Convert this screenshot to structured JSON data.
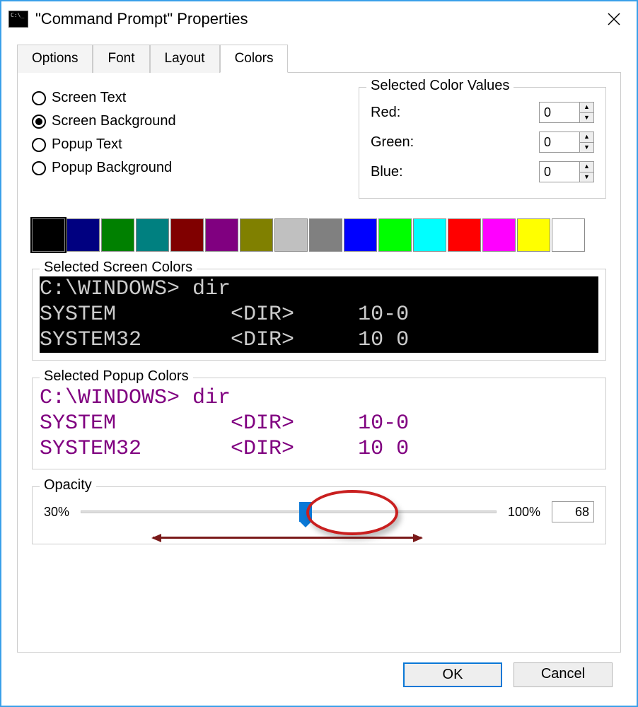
{
  "window": {
    "title": "\"Command Prompt\" Properties"
  },
  "tabs": {
    "items": [
      "Options",
      "Font",
      "Layout",
      "Colors"
    ],
    "active": 3
  },
  "radios": {
    "items": [
      {
        "label": "Screen Text",
        "selected": false
      },
      {
        "label": "Screen Background",
        "selected": true
      },
      {
        "label": "Popup Text",
        "selected": false
      },
      {
        "label": "Popup Background",
        "selected": false
      }
    ]
  },
  "color_values": {
    "legend": "Selected Color Values",
    "rows": [
      {
        "label": "Red:",
        "value": "0"
      },
      {
        "label": "Green:",
        "value": "0"
      },
      {
        "label": "Blue:",
        "value": "0"
      }
    ]
  },
  "palette": {
    "colors": [
      "#000000",
      "#000080",
      "#008000",
      "#008080",
      "#800000",
      "#800080",
      "#808000",
      "#c0c0c0",
      "#808080",
      "#0000ff",
      "#00ff00",
      "#00ffff",
      "#ff0000",
      "#ff00ff",
      "#ffff00",
      "#ffffff"
    ],
    "selected_index": 0
  },
  "preview_screen": {
    "legend": "Selected Screen Colors",
    "line1": "C:\\WINDOWS> dir",
    "line2": "SYSTEM         <DIR>     10-0",
    "line3": "SYSTEM32       <DIR>     10 0"
  },
  "preview_popup": {
    "legend": "Selected Popup Colors",
    "line1": "C:\\WINDOWS> dir",
    "line2": "SYSTEM         <DIR>     10-0",
    "line3": "SYSTEM32       <DIR>     10 0"
  },
  "opacity": {
    "legend": "Opacity",
    "min_label": "30%",
    "max_label": "100%",
    "value": "68",
    "percent_position": 54
  },
  "footer": {
    "ok": "OK",
    "cancel": "Cancel"
  }
}
